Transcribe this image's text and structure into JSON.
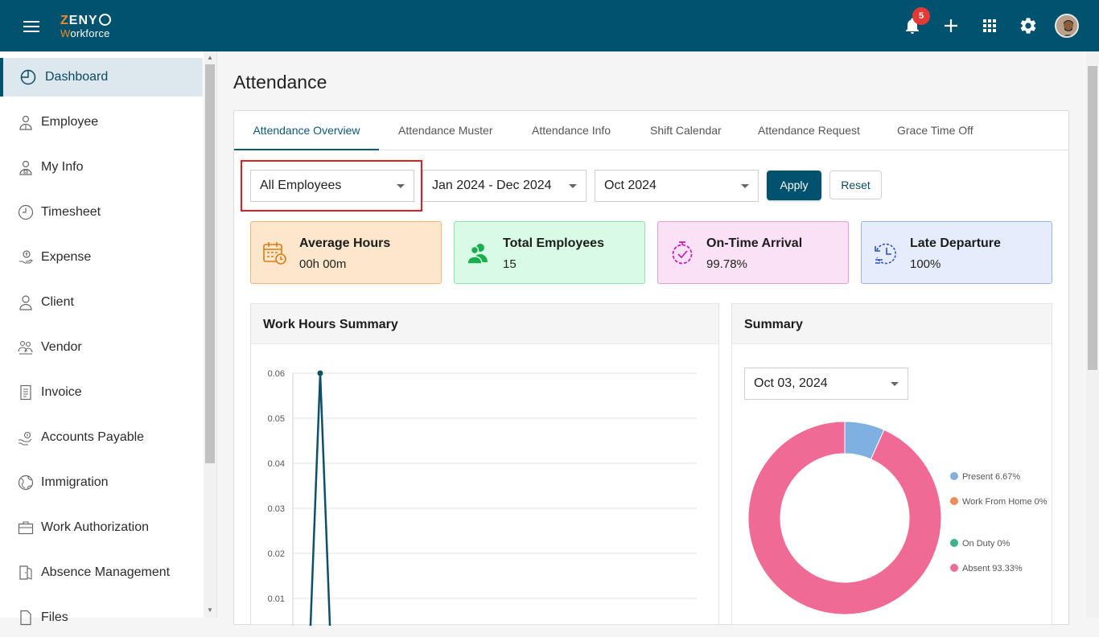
{
  "app": {
    "logo_top": "ZENY",
    "logo_bottom": "Workforce",
    "notification_count": "5"
  },
  "sidebar": {
    "items": [
      {
        "label": "Dashboard",
        "icon": "pie-chart-icon",
        "active": true
      },
      {
        "label": "Employee",
        "icon": "person-icon"
      },
      {
        "label": "My Info",
        "icon": "person-id-icon"
      },
      {
        "label": "Timesheet",
        "icon": "clock-icon"
      },
      {
        "label": "Expense",
        "icon": "money-hand-icon"
      },
      {
        "label": "Client",
        "icon": "user-icon"
      },
      {
        "label": "Vendor",
        "icon": "vendor-icon"
      },
      {
        "label": "Invoice",
        "icon": "document-icon"
      },
      {
        "label": "Accounts Payable",
        "icon": "hand-coin-icon"
      },
      {
        "label": "Immigration",
        "icon": "globe-icon"
      },
      {
        "label": "Work Authorization",
        "icon": "briefcase-icon"
      },
      {
        "label": "Absence Management",
        "icon": "door-exit-icon"
      },
      {
        "label": "Files",
        "icon": "file-icon"
      }
    ]
  },
  "page": {
    "title": "Attendance"
  },
  "tabs": [
    {
      "label": "Attendance Overview",
      "active": true
    },
    {
      "label": "Attendance Muster"
    },
    {
      "label": "Attendance Info"
    },
    {
      "label": "Shift Calendar"
    },
    {
      "label": "Attendance Request"
    },
    {
      "label": "Grace Time Off"
    }
  ],
  "filters": {
    "employee": "All Employees",
    "date_range": "Jan 2024 - Dec 2024",
    "month": "Oct 2024",
    "apply_label": "Apply",
    "reset_label": "Reset"
  },
  "stats": [
    {
      "label": "Average Hours",
      "value": "00h 00m",
      "bg": "#fde7cc",
      "border": "#f1b673",
      "icon": "calendar-clock-icon",
      "icon_color": "#e07b12"
    },
    {
      "label": "Total Employees",
      "value": "15",
      "bg": "#d9fbe6",
      "border": "#8fe0ae",
      "icon": "users-icon",
      "icon_color": "#18b04f"
    },
    {
      "label": "On-Time Arrival",
      "value": "99.78%",
      "bg": "#fbe1f6",
      "border": "#e79be0",
      "icon": "timer-check-icon",
      "icon_color": "#c71cb5"
    },
    {
      "label": "Late Departure",
      "value": "100%",
      "bg": "#e5ecfc",
      "border": "#9db3e8",
      "icon": "clock-arrow-icon",
      "icon_color": "#2c4fc2"
    }
  ],
  "work_hours": {
    "title": "Work Hours Summary"
  },
  "summary": {
    "title": "Summary",
    "date": "Oct 03, 2024"
  },
  "chart_data": [
    {
      "type": "line",
      "title": "Work Hours Summary",
      "xlabel": "",
      "ylabel": "",
      "ylim": [
        0,
        0.06
      ],
      "y_ticks": [
        "0.06",
        "0.05",
        "0.04",
        "0.03",
        "0.02",
        "0.01"
      ],
      "grid": true,
      "series": [
        {
          "values": [
            0,
            0.06,
            0
          ],
          "color": "#0e4f6a"
        }
      ]
    },
    {
      "type": "pie",
      "title": "Summary",
      "donut": true,
      "legend_position": "right",
      "slices": [
        {
          "label": "Present 6.67%",
          "value": 6.67,
          "color": "#7fb0e2"
        },
        {
          "label": "Work From Home 0%",
          "value": 0,
          "color": "#ef8a5a"
        },
        {
          "label": "On Duty 0%",
          "value": 0,
          "color": "#3cb38a"
        },
        {
          "label": "Absent 93.33%",
          "value": 93.33,
          "color": "#ef6b96"
        }
      ]
    }
  ]
}
